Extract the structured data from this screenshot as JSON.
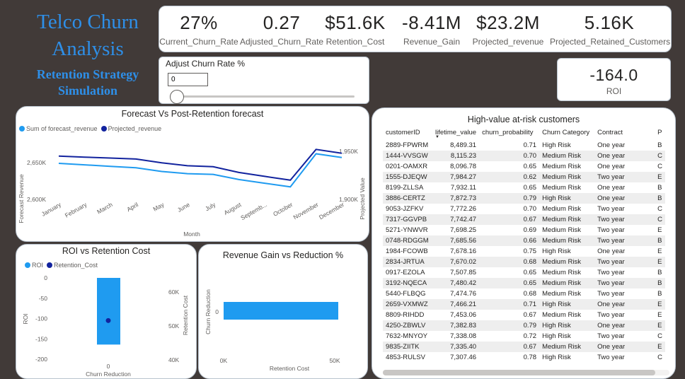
{
  "title": {
    "main": "Telco Churn Analysis",
    "sub": "Retention Strategy Simulation"
  },
  "kpis": [
    {
      "value": "27%",
      "label": "Current_Churn_Rate"
    },
    {
      "value": "0.27",
      "label": "Adjusted_Churn_Rate"
    },
    {
      "value": "$51.6K",
      "label": "Retention_Cost"
    },
    {
      "value": "-8.41M",
      "label": "Revenue_Gain"
    },
    {
      "value": "$23.2M",
      "label": "Projected_revenue"
    },
    {
      "value": "5.16K",
      "label": "Projected_Retained_Customers"
    }
  ],
  "slider": {
    "label": "Adjust Churn Rate %",
    "value": "0"
  },
  "roi": {
    "value": "-164.0",
    "label": "ROI"
  },
  "colors": {
    "light_blue": "#1f9bf0",
    "dark_blue": "#12239e",
    "title_blue": "#2e8fe8"
  },
  "chart_data": [
    {
      "type": "line",
      "title": "Forecast Vs Post-Retention forecast",
      "xlabel": "Month",
      "ylabel": "Forecast Revenue",
      "y2label": "Projected Value",
      "categories": [
        "January",
        "February",
        "March",
        "April",
        "May",
        "June",
        "July",
        "August",
        "Septemb...",
        "October",
        "November",
        "December"
      ],
      "yticks": [
        "2,650K",
        "2,600K"
      ],
      "y2ticks": [
        "1,950K",
        "1,900K"
      ],
      "ylim": [
        2590,
        2680
      ],
      "y2lim": [
        1895,
        1958
      ],
      "series": [
        {
          "name": "Sum of forecast_revenue",
          "axis": "left",
          "values": [
            2649,
            2647,
            2645,
            2643,
            2638,
            2635,
            2634,
            2627,
            2622,
            2617,
            2662,
            2657
          ]
        },
        {
          "name": "Projected_revenue",
          "axis": "right",
          "values": [
            1945,
            1944,
            1943,
            1942,
            1938,
            1935,
            1934,
            1928,
            1924,
            1920,
            1952,
            1948
          ]
        }
      ]
    },
    {
      "type": "bar",
      "title": "ROI vs Retention Cost",
      "xlabel": "Churn Reduction",
      "ylabel": "ROI",
      "y2label": "Retention Cost",
      "categories": [
        "0"
      ],
      "yticks": [
        "0",
        "-50",
        "-100",
        "-150",
        "-200"
      ],
      "y2ticks": [
        "60K",
        "50K",
        "40K"
      ],
      "ylim": [
        -200,
        0
      ],
      "y2lim": [
        40,
        68
      ],
      "series": [
        {
          "name": "ROI",
          "values": [
            -164.0
          ]
        },
        {
          "name": "Retention_Cost",
          "values": [
            51.6
          ]
        }
      ]
    },
    {
      "type": "bar",
      "title": "Revenue Gain vs Reduction %",
      "xlabel": "Retention Cost",
      "ylabel": "Churn Reduction",
      "categories": [
        "0"
      ],
      "xticks": [
        "0K",
        "50K"
      ],
      "xlim": [
        0,
        50
      ],
      "series": [
        {
          "name": "Retention Cost",
          "values": [
            51.6
          ]
        }
      ]
    }
  ],
  "table": {
    "title": "High-value at-risk customers",
    "columns": [
      "customerID",
      "lifetime_value",
      "churn_probability",
      "Churn Category",
      "Contract",
      "P"
    ],
    "rows": [
      [
        "2889-FPWRM",
        "8,489.31",
        "0.71",
        "High Risk",
        "One year",
        "B"
      ],
      [
        "1444-VVSGW",
        "8,115.23",
        "0.70",
        "Medium Risk",
        "One year",
        "C"
      ],
      [
        "0201-OAMXR",
        "8,096.78",
        "0.65",
        "Medium Risk",
        "One year",
        "C"
      ],
      [
        "1555-DJEQW",
        "7,984.27",
        "0.62",
        "Medium Risk",
        "Two year",
        "E"
      ],
      [
        "8199-ZLLSA",
        "7,932.11",
        "0.65",
        "Medium Risk",
        "One year",
        "B"
      ],
      [
        "3886-CERTZ",
        "7,872.73",
        "0.79",
        "High Risk",
        "One year",
        "B"
      ],
      [
        "9053-JZFKV",
        "7,772.26",
        "0.70",
        "Medium Risk",
        "Two year",
        "C"
      ],
      [
        "7317-GGVPB",
        "7,742.47",
        "0.67",
        "Medium Risk",
        "Two year",
        "C"
      ],
      [
        "5271-YNWVR",
        "7,698.25",
        "0.69",
        "Medium Risk",
        "Two year",
        "E"
      ],
      [
        "0748-RDGGM",
        "7,685.56",
        "0.66",
        "Medium Risk",
        "Two year",
        "B"
      ],
      [
        "1984-FCOWB",
        "7,678.16",
        "0.75",
        "High Risk",
        "One year",
        "E"
      ],
      [
        "2834-JRTUA",
        "7,670.02",
        "0.68",
        "Medium Risk",
        "Two year",
        "E"
      ],
      [
        "0917-EZOLA",
        "7,507.85",
        "0.65",
        "Medium Risk",
        "Two year",
        "B"
      ],
      [
        "3192-NQECA",
        "7,480.42",
        "0.65",
        "Medium Risk",
        "Two year",
        "B"
      ],
      [
        "5440-FLBQG",
        "7,474.76",
        "0.68",
        "Medium Risk",
        "Two year",
        "B"
      ],
      [
        "2659-VXMWZ",
        "7,466.21",
        "0.71",
        "High Risk",
        "One year",
        "E"
      ],
      [
        "8809-RIHDD",
        "7,453.06",
        "0.67",
        "Medium Risk",
        "Two year",
        "E"
      ],
      [
        "4250-ZBWLV",
        "7,382.83",
        "0.79",
        "High Risk",
        "One year",
        "E"
      ],
      [
        "7632-MNYOY",
        "7,338.08",
        "0.72",
        "High Risk",
        "Two year",
        "C"
      ],
      [
        "9835-ZIITK",
        "7,335.40",
        "0.67",
        "Medium Risk",
        "One year",
        "E"
      ],
      [
        "4853-RULSV",
        "7,307.46",
        "0.78",
        "High Risk",
        "Two year",
        "C"
      ]
    ]
  }
}
